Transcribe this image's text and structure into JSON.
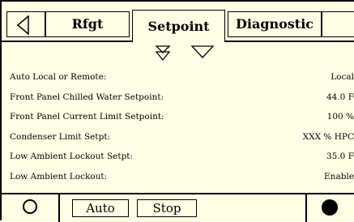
{
  "tabs": {
    "rfgt": "Rfgt",
    "setpoint": "Setpoint",
    "diagnostic": "Diagnostic"
  },
  "rows": [
    {
      "label": "Auto Local or Remote:",
      "value": "Local"
    },
    {
      "label": "Front Panel Chilled Water Setpoint:",
      "value": "44.0  F"
    },
    {
      "label": "Front Panel Current Limit Setpoint:",
      "value": "100  %"
    },
    {
      "label": "Condenser Limit Setpt:",
      "value": "XXX % HPC"
    },
    {
      "label": "Low Ambient Lockout Setpt:",
      "value": "35.0  F"
    },
    {
      "label": "Low Ambient Lockout:",
      "value": "Enable"
    }
  ],
  "bottom": {
    "auto_label": "Auto",
    "stop_label": "Stop"
  }
}
